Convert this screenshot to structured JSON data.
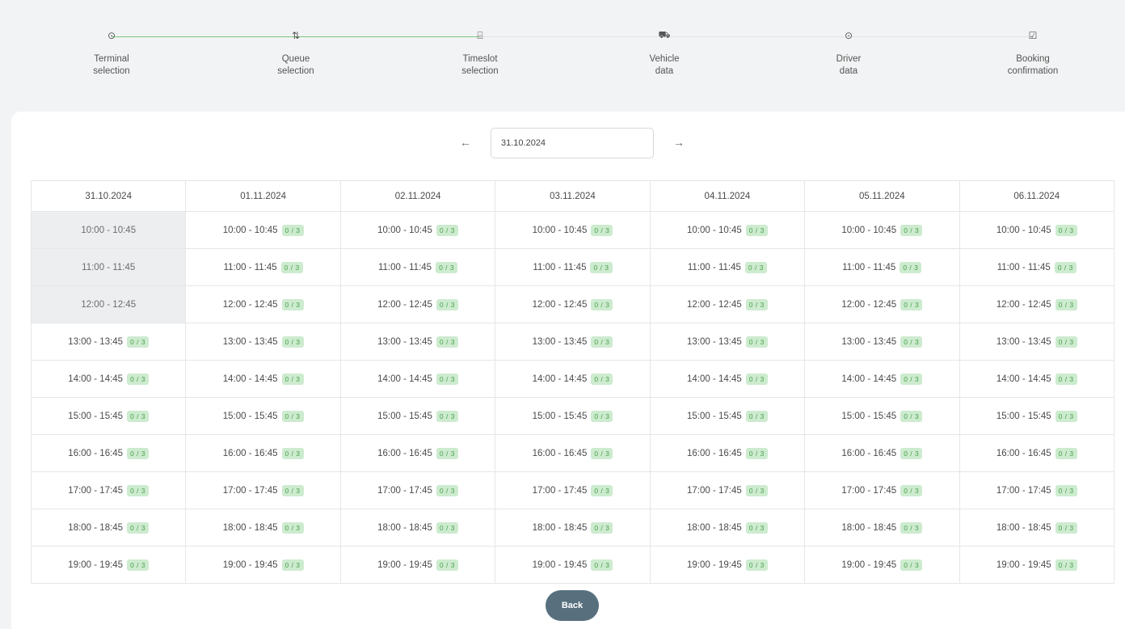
{
  "stepper": {
    "steps": [
      {
        "line1": "Terminal",
        "line2": "selection",
        "state": "done",
        "icon": "map-pin-icon",
        "glyph": "⊙"
      },
      {
        "line1": "Queue",
        "line2": "selection",
        "state": "done",
        "icon": "sort-arrows-icon",
        "glyph": "⇅"
      },
      {
        "line1": "Timeslot",
        "line2": "selection",
        "state": "active",
        "icon": "calendar-icon",
        "glyph": "⌸"
      },
      {
        "line1": "Vehicle",
        "line2": "data",
        "state": "pending",
        "icon": "truck-icon",
        "glyph": "⛟"
      },
      {
        "line1": "Driver",
        "line2": "data",
        "state": "pending",
        "icon": "user-icon",
        "glyph": "⊙"
      },
      {
        "line1": "Booking",
        "line2": "confirmation",
        "state": "pending",
        "icon": "check-square-icon",
        "glyph": "☑"
      }
    ],
    "colors": {
      "done": "#7cc77a",
      "active": "#e08a3c",
      "pending": "#d7d9dc"
    }
  },
  "date_nav": {
    "prev_glyph": "←",
    "next_glyph": "→",
    "value": "31.10.2024"
  },
  "table": {
    "columns": [
      "31.10.2024",
      "01.11.2024",
      "02.11.2024",
      "03.11.2024",
      "04.11.2024",
      "05.11.2024",
      "06.11.2024"
    ],
    "times": [
      "10:00 - 10:45",
      "11:00 - 11:45",
      "12:00 - 12:45",
      "13:00 - 13:45",
      "14:00 - 14:45",
      "15:00 - 15:45",
      "16:00 - 16:45",
      "17:00 - 17:45",
      "18:00 - 18:45",
      "19:00 - 19:45"
    ],
    "badge": "0 / 3",
    "past_slots_first_column": 3
  },
  "back_label": "Back"
}
